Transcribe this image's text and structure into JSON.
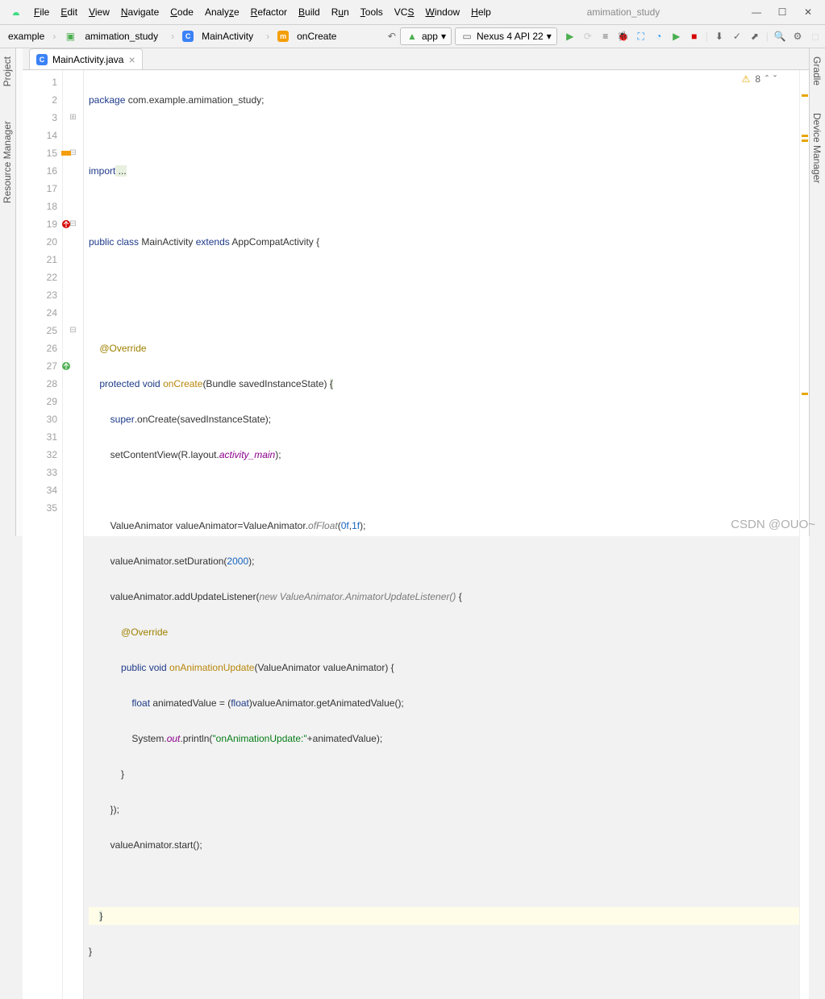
{
  "project_name": "amimation_study",
  "menus": [
    "File",
    "Edit",
    "View",
    "Navigate",
    "Code",
    "Analyze",
    "Refactor",
    "Build",
    "Run",
    "Tools",
    "VCS",
    "Window",
    "Help"
  ],
  "breadcrumb": {
    "items": [
      "example",
      "amimation_study",
      "MainActivity",
      "onCreate"
    ]
  },
  "run_config": "app",
  "device": "Nexus 4 API 22",
  "tab_file": "MainActivity.java",
  "left_tabs": [
    "Project",
    "Resource Manager"
  ],
  "right_tabs": [
    "Gradle",
    "Device Manager"
  ],
  "inspector": {
    "warn_count": "8"
  },
  "watermark": "CSDN @OUO~",
  "code": {
    "l1a": "package",
    "l1b": " com.example.amimation_study;",
    "l3a": "import",
    "l3b": " ...",
    "l15": "public class",
    "l15b": " MainActivity ",
    "l15c": "extends",
    "l15d": " AppCompatActivity {",
    "l18": "@Override",
    "l19a": "protected void",
    "l19b": " onCreate",
    "l19c": "(Bundle savedInstanceState) ",
    "l19d": "{",
    "l20a": "super",
    "l20b": ".onCreate(savedInstanceState);",
    "l21a": "        setContentView(R.layout.",
    "l21b": "activity_main",
    "l21c": ");",
    "l23a": "        ValueAnimator valueAnimator=ValueAnimator.",
    "l23b": "ofFloat",
    "l23c": "(",
    "l23d": "0f",
    "l23e": ",",
    "l23f": "1f",
    "l23g": ");",
    "l24a": "        valueAnimator.setDuration(",
    "l24b": "2000",
    "l24c": ");",
    "l25a": "        valueAnimator.addUpdateListener(",
    "l25b": "new ValueAnimator.AnimatorUpdateListener()",
    "l25c": " {",
    "l26": "@Override",
    "l27a": "public void",
    "l27b": " onAnimationUpdate",
    "l27c": "(ValueAnimator valueAnimator) {",
    "l28a": "float",
    "l28b": " animatedValue = (",
    "l28c": "float",
    "l28d": ")valueAnimator.getAnimatedValue();",
    "l29a": "                System.",
    "l29b": "out",
    "l29c": ".println(",
    "l29d": "\"onAnimationUpdate:\"",
    "l29e": "+animatedValue);",
    "l30": "            }",
    "l31": "        });",
    "l32": "        valueAnimator.start();",
    "l34": "}",
    "l35": "}"
  },
  "lines": [
    1,
    2,
    3,
    14,
    15,
    16,
    17,
    18,
    19,
    20,
    21,
    22,
    23,
    24,
    25,
    26,
    27,
    28,
    29,
    30,
    31,
    32,
    33,
    34,
    35
  ]
}
